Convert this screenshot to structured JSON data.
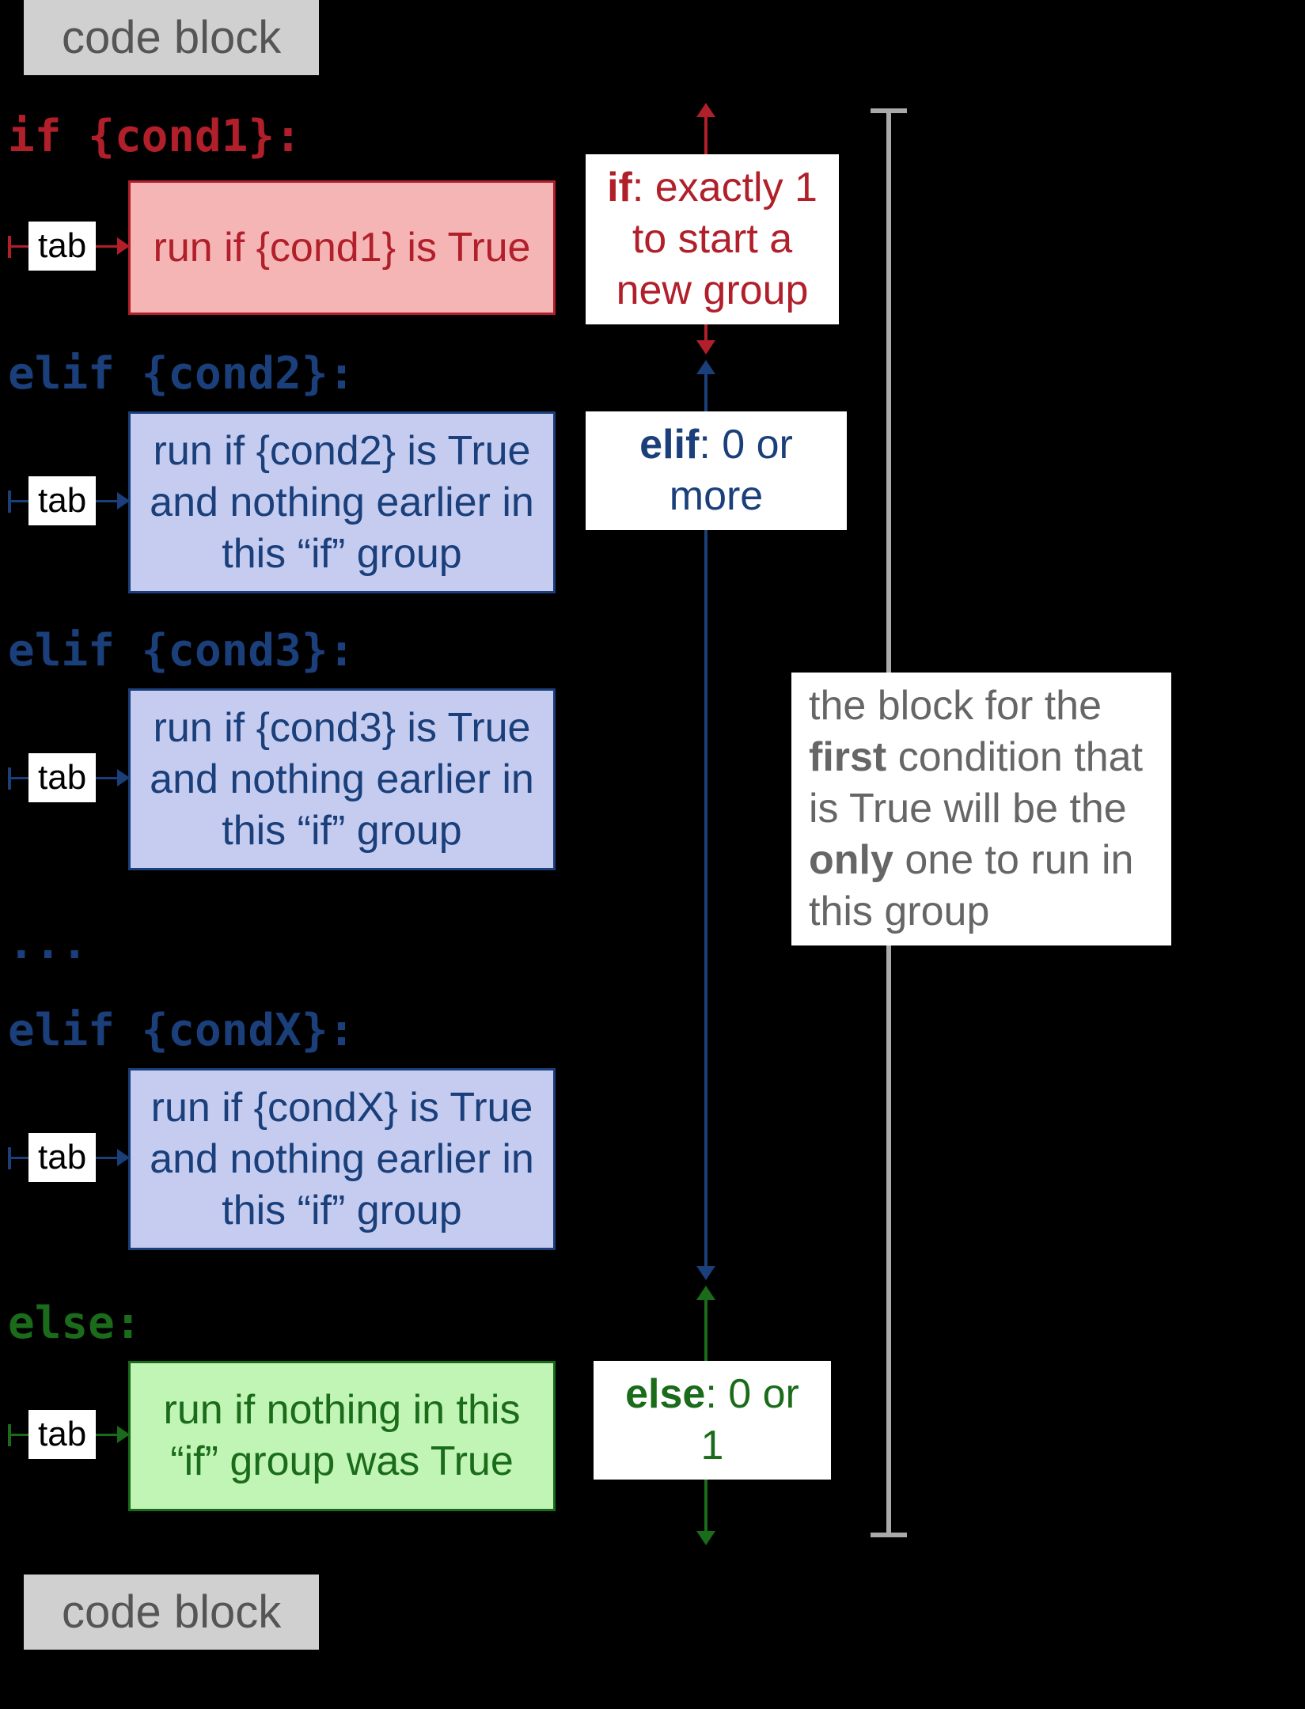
{
  "labels": {
    "code_block": "code block",
    "tab": "tab",
    "ellipsis": "..."
  },
  "colors": {
    "red": "#b11f2a",
    "blue": "#1a3f7a",
    "green": "#1a6b1a",
    "grey": "#888888",
    "red_fill": "#f5b5b5",
    "blue_fill": "#c5ccf0",
    "green_fill": "#c0f5b5",
    "codeblock_bg": "#d0d0d0"
  },
  "lines": {
    "if": "if {cond1}:",
    "elif1": "elif {cond2}:",
    "elif2": "elif {cond3}:",
    "elifX": "elif {condX}:",
    "else": "else:"
  },
  "boxes": {
    "if": "run if {cond1} is True",
    "elif1": "run if {cond2} is True and nothing earlier in this “if” group",
    "elif2": "run if {cond3} is True and nothing earlier in this “if” group",
    "elifX": "run if {condX} is True and nothing earlier in this “if” group",
    "else": "run if nothing in this “if” group was True"
  },
  "annotations": {
    "if_keyword": "if",
    "if_rest": ": exactly 1 to start a new group",
    "elif_keyword": "elif",
    "elif_rest": ": 0 or more",
    "else_keyword": "else",
    "else_rest": ": 0 or 1",
    "summary_pre": "the block for the ",
    "summary_first": "first",
    "summary_mid": " condition that is True will be the ",
    "summary_only": "only",
    "summary_post": " one to run in this group"
  }
}
